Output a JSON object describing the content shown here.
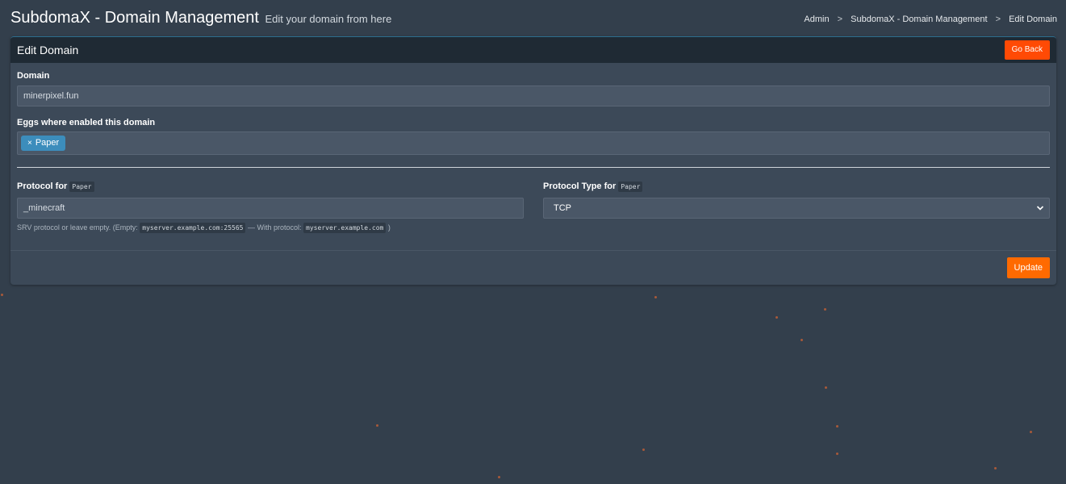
{
  "header": {
    "title": "SubdomaX - Domain Management",
    "subtitle": "Edit your domain from here",
    "breadcrumb": [
      "Admin",
      "SubdomaX - Domain Management",
      "Edit Domain"
    ],
    "breadcrumb_sep": ">"
  },
  "box": {
    "title": "Edit Domain",
    "go_back_label": "Go Back",
    "domain_label": "Domain",
    "domain_value": "minerpixel.fun",
    "eggs_label": "Eggs where enabled this domain",
    "eggs": [
      {
        "remove": "×",
        "label": "Paper"
      }
    ],
    "protocol_label": "Protocol for",
    "protocol_egg": "Paper",
    "protocol_value": "_minecraft",
    "protocol_help_prefix": "SRV protocol or leave empty. (Empty:",
    "protocol_help_empty_example": "myserver.example.com:25565",
    "protocol_help_mid": "— With protocol:",
    "protocol_help_with_example": "myserver.example.com",
    "protocol_help_suffix": ")",
    "protocol_type_label": "Protocol Type for",
    "protocol_type_egg": "Paper",
    "protocol_type_value": "TCP",
    "update_label": "Update"
  },
  "colors": {
    "background": "#333f4c",
    "go_back": "#ff4a05",
    "update": "#ff6a00",
    "tag": "#3c8dbc"
  }
}
